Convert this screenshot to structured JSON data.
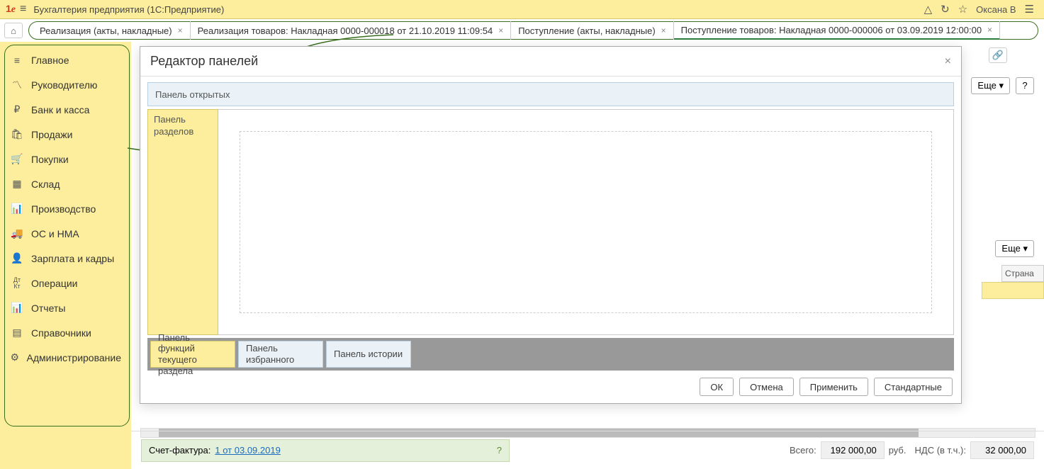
{
  "titlebar": {
    "logo": "1C",
    "title": "Бухгалтерия предприятия   (1С:Предприятие)",
    "user": "Оксана В"
  },
  "tabs": [
    {
      "label": "Реализация (акты, накладные)"
    },
    {
      "label": "Реализация товаров: Накладная 0000-000018 от 21.10.2019 11:09:54"
    },
    {
      "label": "Поступление (акты, накладные)"
    },
    {
      "label": "Поступление товаров: Накладная 0000-000006 от 03.09.2019 12:00:00",
      "active": true
    }
  ],
  "sidebar": {
    "items": [
      {
        "icon": "≡",
        "label": "Главное"
      },
      {
        "icon": "📈",
        "label": "Руководителю"
      },
      {
        "icon": "₽",
        "label": "Банк и касса"
      },
      {
        "icon": "🛍",
        "label": "Продажи"
      },
      {
        "icon": "🛒",
        "label": "Покупки"
      },
      {
        "icon": "▦",
        "label": "Склад"
      },
      {
        "icon": "🏭",
        "label": "Производство"
      },
      {
        "icon": "🚚",
        "label": "ОС и НМА"
      },
      {
        "icon": "👤",
        "label": "Зарплата и кадры"
      },
      {
        "icon": "Дт",
        "label": "Операции"
      },
      {
        "icon": "📊",
        "label": "Отчеты"
      },
      {
        "icon": "📚",
        "label": "Справочники"
      },
      {
        "icon": "⚙",
        "label": "Администрирование"
      }
    ]
  },
  "dialog": {
    "title": "Редактор панелей",
    "panel_open": "Панель открытых",
    "panel_sections": "Панель разделов",
    "strip": {
      "functions": "Панель функций текущего раздела",
      "favorites": "Панель избранного",
      "history": "Панель истории"
    },
    "buttons": {
      "ok": "ОК",
      "cancel": "Отмена",
      "apply": "Применить",
      "standard": "Стандартные"
    }
  },
  "right": {
    "more": "Еще ▾",
    "help": "?",
    "column": "Страна"
  },
  "footer": {
    "invoice_label": "Счет-фактура:",
    "invoice_link": "1 от 03.09.2019",
    "total_label": "Всего:",
    "total_value": "192 000,00",
    "currency": "руб.",
    "vat_label": "НДС (в т.ч.):",
    "vat_value": "32 000,00"
  }
}
